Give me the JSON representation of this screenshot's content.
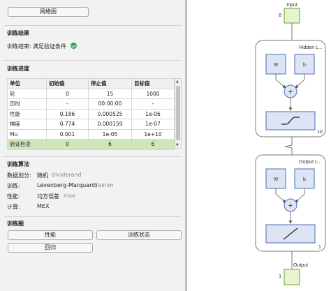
{
  "view_button": "网络图",
  "results": {
    "heading": "训练结果",
    "label": "训练结束:",
    "value": "满足验证条件"
  },
  "progress": {
    "heading": "训练进度",
    "headers": [
      "单位",
      "初始值",
      "停止值",
      "目标值"
    ],
    "rows": [
      [
        "轮",
        "0",
        "15",
        "1000"
      ],
      [
        "历时",
        "-",
        "00:00:00",
        "-"
      ],
      [
        "性能",
        "0.186",
        "0.000525",
        "1e-06"
      ],
      [
        "梯度",
        "0.774",
        "0.000159",
        "1e-07"
      ],
      [
        "Mu",
        "0.001",
        "1e-05",
        "1e+10"
      ],
      [
        "验证检查",
        "0",
        "6",
        "6"
      ]
    ]
  },
  "algorithms": {
    "heading": "训练算法",
    "items": [
      {
        "label": "数据划分:",
        "value": "随机",
        "fn": "dividerand"
      },
      {
        "label": "训练:",
        "value": "Levenberg-Marquardt",
        "fn": "trainlm"
      },
      {
        "label": "性能:",
        "value": "均方误差",
        "fn": "mse"
      },
      {
        "label": "计算:",
        "value": "MEX",
        "fn": ""
      }
    ]
  },
  "plots": {
    "heading": "训练图",
    "performance": "性能",
    "state": "训练状态",
    "regression": "回归"
  },
  "diagram": {
    "input_label": "Input",
    "input_size": "8",
    "hidden_title": "Hidden L...",
    "hidden_size": "10",
    "output_title": "Output L...",
    "output_size": "1",
    "output_label": "Output",
    "output_node_size": "1",
    "weight_label": "W",
    "bias_label": "b",
    "sum_symbol": "+"
  },
  "colors": {
    "node_fill": "#dde4f3",
    "node_stroke": "#4a6cb3",
    "io_fill": "#e6f5d0",
    "io_stroke": "#7bb34d",
    "highlight_row": "#cfe6bb"
  }
}
